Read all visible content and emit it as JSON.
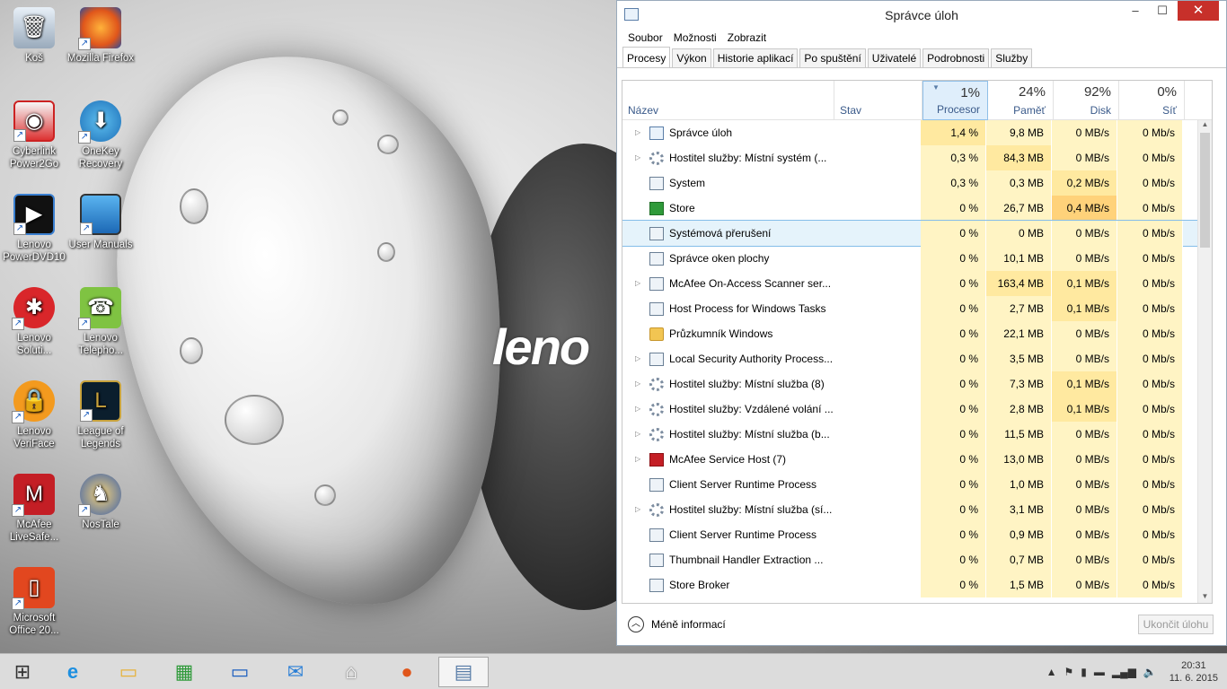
{
  "desktop": {
    "icons": [
      {
        "label": "Koš",
        "icon": "recycle-bin-icon"
      },
      {
        "label": "Mozilla Firefox",
        "icon": "firefox-icon"
      },
      {
        "label": "Cyberlink Power2Go",
        "icon": "power2go-icon"
      },
      {
        "label": "OneKey Recovery",
        "icon": "onekey-recovery-icon"
      },
      {
        "label": "Lenovo PowerDVD10",
        "icon": "powerdvd-icon"
      },
      {
        "label": "User Manuals",
        "icon": "user-manuals-icon"
      },
      {
        "label": "Lenovo Soluti...",
        "icon": "lenovo-solutions-icon"
      },
      {
        "label": "Lenovo Telepho...",
        "icon": "lenovo-telephony-icon"
      },
      {
        "label": "Lenovo VeriFace",
        "icon": "veriface-icon"
      },
      {
        "label": "League of Legends",
        "icon": "league-of-legends-icon"
      },
      {
        "label": "McAfee LiveSafe...",
        "icon": "mcafee-livesafe-icon"
      },
      {
        "label": "NosTale",
        "icon": "nostale-icon"
      },
      {
        "label": "Microsoft Office 20...",
        "icon": "office-icon"
      }
    ],
    "wallpaper_brand": "leno"
  },
  "window": {
    "title": "Správce úloh",
    "minimize": "–",
    "maximize": "☐",
    "close": "✕",
    "menu": [
      "Soubor",
      "Možnosti",
      "Zobrazit"
    ],
    "tabs": [
      "Procesy",
      "Výkon",
      "Historie aplikací",
      "Po spuštění",
      "Uživatelé",
      "Podrobnosti",
      "Služby"
    ],
    "active_tab": "Procesy"
  },
  "columns": {
    "name": "Název",
    "status": "Stav",
    "cpu": {
      "pct": "1%",
      "label": "Procesor"
    },
    "mem": {
      "pct": "24%",
      "label": "Paměť"
    },
    "disk": {
      "pct": "92%",
      "label": "Disk"
    },
    "net": {
      "pct": "0%",
      "label": "Síť"
    }
  },
  "processes": [
    {
      "name": "Správce úloh",
      "icon": "taskmgr",
      "expand": true,
      "cpu": "1,4 %",
      "mem": "9,8 MB",
      "disk": "0 MB/s",
      "net": "0 Mb/s"
    },
    {
      "name": "Hostitel služby: Místní systém (...",
      "icon": "gear",
      "expand": true,
      "cpu": "0,3 %",
      "mem": "84,3 MB",
      "disk": "0 MB/s",
      "net": "0 Mb/s"
    },
    {
      "name": "System",
      "icon": "window",
      "expand": false,
      "cpu": "0,3 %",
      "mem": "0,3 MB",
      "disk": "0,2 MB/s",
      "net": "0 Mb/s"
    },
    {
      "name": "Store",
      "icon": "store",
      "expand": false,
      "cpu": "0 %",
      "mem": "26,7 MB",
      "disk": "0,4 MB/s",
      "net": "0 Mb/s"
    },
    {
      "name": "Systémová přerušení",
      "icon": "window",
      "expand": false,
      "cpu": "0 %",
      "mem": "0 MB",
      "disk": "0 MB/s",
      "net": "0 Mb/s",
      "selected": true
    },
    {
      "name": "Správce oken plochy",
      "icon": "window",
      "expand": false,
      "cpu": "0 %",
      "mem": "10,1 MB",
      "disk": "0 MB/s",
      "net": "0 Mb/s"
    },
    {
      "name": "McAfee On-Access Scanner ser...",
      "icon": "window",
      "expand": true,
      "cpu": "0 %",
      "mem": "163,4 MB",
      "disk": "0,1 MB/s",
      "net": "0 Mb/s"
    },
    {
      "name": "Host Process for Windows Tasks",
      "icon": "window",
      "expand": false,
      "cpu": "0 %",
      "mem": "2,7 MB",
      "disk": "0,1 MB/s",
      "net": "0 Mb/s"
    },
    {
      "name": "Průzkumník Windows",
      "icon": "folder",
      "expand": false,
      "cpu": "0 %",
      "mem": "22,1 MB",
      "disk": "0 MB/s",
      "net": "0 Mb/s"
    },
    {
      "name": "Local Security Authority Process...",
      "icon": "window",
      "expand": true,
      "cpu": "0 %",
      "mem": "3,5 MB",
      "disk": "0 MB/s",
      "net": "0 Mb/s"
    },
    {
      "name": "Hostitel služby: Místní služba (8)",
      "icon": "gear",
      "expand": true,
      "cpu": "0 %",
      "mem": "7,3 MB",
      "disk": "0,1 MB/s",
      "net": "0 Mb/s"
    },
    {
      "name": "Hostitel služby: Vzdálené volání ...",
      "icon": "gear",
      "expand": true,
      "cpu": "0 %",
      "mem": "2,8 MB",
      "disk": "0,1 MB/s",
      "net": "0 Mb/s"
    },
    {
      "name": "Hostitel služby: Místní služba (b...",
      "icon": "gear",
      "expand": true,
      "cpu": "0 %",
      "mem": "11,5 MB",
      "disk": "0 MB/s",
      "net": "0 Mb/s"
    },
    {
      "name": "McAfee Service Host (7)",
      "icon": "mcafee",
      "expand": true,
      "cpu": "0 %",
      "mem": "13,0 MB",
      "disk": "0 MB/s",
      "net": "0 Mb/s"
    },
    {
      "name": "Client Server Runtime Process",
      "icon": "window",
      "expand": false,
      "cpu": "0 %",
      "mem": "1,0 MB",
      "disk": "0 MB/s",
      "net": "0 Mb/s"
    },
    {
      "name": "Hostitel služby: Místní služba (sí...",
      "icon": "gear",
      "expand": true,
      "cpu": "0 %",
      "mem": "3,1 MB",
      "disk": "0 MB/s",
      "net": "0 Mb/s"
    },
    {
      "name": "Client Server Runtime Process",
      "icon": "window",
      "expand": false,
      "cpu": "0 %",
      "mem": "0,9 MB",
      "disk": "0 MB/s",
      "net": "0 Mb/s"
    },
    {
      "name": "Thumbnail Handler Extraction ...",
      "icon": "window",
      "expand": false,
      "cpu": "0 %",
      "mem": "0,7 MB",
      "disk": "0 MB/s",
      "net": "0 Mb/s"
    },
    {
      "name": "Store Broker",
      "icon": "window",
      "expand": false,
      "cpu": "0 %",
      "mem": "1,5 MB",
      "disk": "0 MB/s",
      "net": "0 Mb/s"
    }
  ],
  "footer": {
    "less_info": "Méně informací",
    "end_task": "Ukončit úlohu"
  },
  "taskbar": {
    "items": [
      "start-icon",
      "internet-explorer-icon",
      "file-explorer-icon",
      "store-icon",
      "lenovo-app-icon",
      "mail-icon",
      "home-icon",
      "firefox-icon",
      "task-manager-icon"
    ],
    "time": "20:31",
    "date": "11. 6. 2015"
  },
  "colors": {
    "heat_low": "#fff4c4",
    "heat_mid": "#ffe9a0",
    "heat_high": "#ffd27a",
    "close_red": "#c7302a",
    "header_blue": "#3a5a8a"
  }
}
